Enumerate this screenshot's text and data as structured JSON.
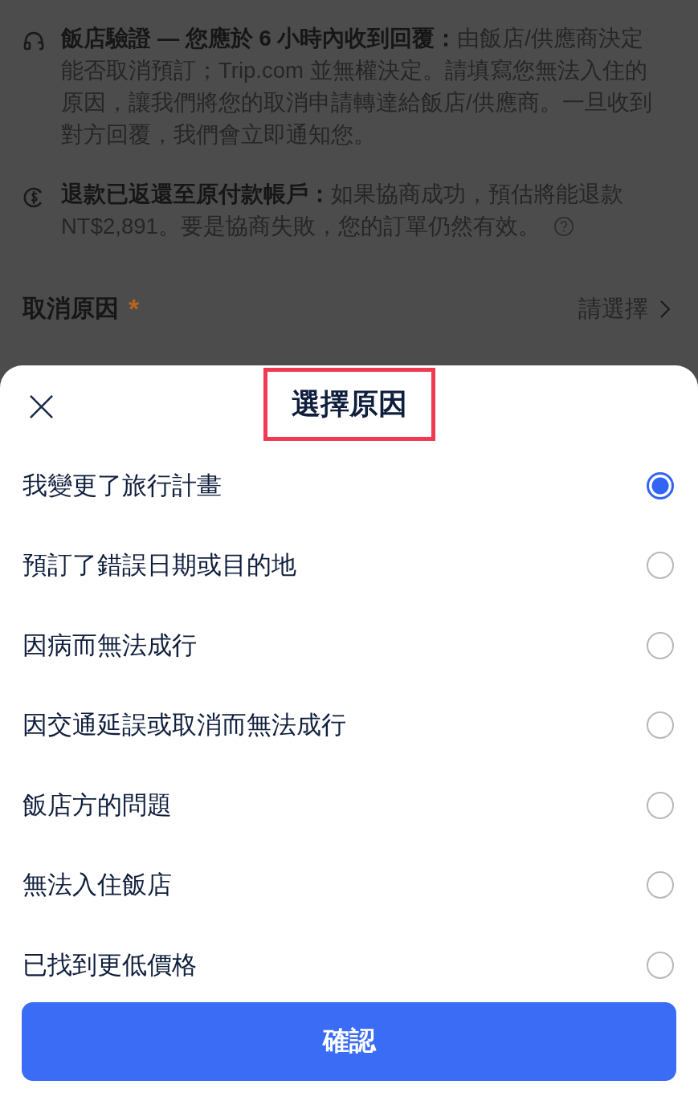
{
  "notices": [
    {
      "kind": "headset",
      "text": "**飯店驗證 — 您應於 6 小時內收到回覆：**由飯店/供應商決定能否取消預訂；Trip.com 並無權決定。請填寫您無法入住的原因，讓我們將您的取消申請轉達給飯店/供應商。一旦收到對方回覆，我們會立即通知您。",
      "help": false
    },
    {
      "kind": "refund",
      "text": "**退款已返還至原付款帳戶：**如果協商成功，預估將能退款NT$2,891。要是協商失敗，您的訂單仍然有效。",
      "help": true
    }
  ],
  "reason_field": {
    "label": "取消原因",
    "required_mark": "*",
    "value": "請選擇"
  },
  "sheet": {
    "title": "選擇原因",
    "title_highlighted": true,
    "options": [
      {
        "label": "我變更了旅行計畫",
        "selected": true
      },
      {
        "label": "預訂了錯誤日期或目的地",
        "selected": false
      },
      {
        "label": "因病而無法成行",
        "selected": false
      },
      {
        "label": "因交通延誤或取消而無法成行",
        "selected": false
      },
      {
        "label": "飯店方的問題",
        "selected": false
      },
      {
        "label": "無法入住飯店",
        "selected": false
      },
      {
        "label": "已找到更低價格",
        "selected": false
      }
    ],
    "confirm": "確認"
  }
}
